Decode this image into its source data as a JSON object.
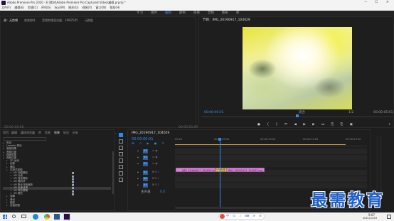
{
  "window": {
    "title": "Adobe Premiere Pro 2020 - E:\\素材\\Adobe Premiere Pro Captured Video\\编辑.prproj *",
    "controls": [
      "minimize",
      "maximize",
      "close"
    ]
  },
  "menu": [
    "文件(F)",
    "编辑(E)",
    "剪辑(C)",
    "序列(S)",
    "标记(M)",
    "图形(G)",
    "视图(V)",
    "窗口(W)",
    "帮助(H)"
  ],
  "workspaces": [
    "学习",
    "组件",
    "编辑",
    "颜色",
    "效果",
    "音频",
    "图形",
    "库"
  ],
  "active_workspace": "编辑",
  "source_panel": {
    "tabs": [
      "源：无剪辑",
      "效果控件",
      "音频剪辑混合器：19M2505",
      "元数据"
    ],
    "timecode_left": "00:00:00:00",
    "timecode_right": "00:00:00:00"
  },
  "program_monitor": {
    "tab": "节目：IMG_20190917_104029",
    "timecode": "00:00:00:01",
    "fit": "适合",
    "scale": "1/2",
    "duration": "00:00:05:01"
  },
  "effects_panel": {
    "tabs": [
      "项目：编辑",
      "媒体浏览器",
      "库",
      "信息",
      "效果",
      "标记",
      "历史"
    ],
    "active_tab": "效果",
    "tree": [
      {
        "label": "预设",
        "level": 0
      },
      {
        "label": "Lumetri 预设",
        "level": 0
      },
      {
        "label": "音频效果",
        "level": 0
      },
      {
        "label": "音频过渡",
        "level": 0
      },
      {
        "label": "视频效果",
        "level": 0
      },
      {
        "label": "视频过渡",
        "level": 0
      },
      {
        "label": "3D 运动",
        "level": 1
      },
      {
        "label": "划像",
        "level": 1
      },
      {
        "label": "擦除",
        "level": 1
      },
      {
        "label": "沉浸式视频",
        "level": 1
      },
      {
        "label": "VR 光圈擦除",
        "level": 2
      },
      {
        "label": "VR 光线",
        "level": 2
      },
      {
        "label": "VR 渐变擦除",
        "level": 2
      },
      {
        "label": "VR 随机块",
        "level": 2
      },
      {
        "label": "VR 默比乌斯缩放",
        "level": 2
      },
      {
        "label": "VR 色度泄漏",
        "level": 2,
        "selected": true
      },
      {
        "label": "VR 球形模糊",
        "level": 2
      },
      {
        "label": "VR 漏光",
        "level": 2
      },
      {
        "label": "溶解",
        "level": 1
      },
      {
        "label": "滑动",
        "level": 1
      },
      {
        "label": "缩放",
        "level": 1
      },
      {
        "label": "页面剥落",
        "level": 1
      }
    ]
  },
  "timeline": {
    "tab": "IMG_20190917_104029",
    "timecode": "00:00:00:01",
    "ruler": [
      "00:00",
      "00:00:05:00",
      "00:00:10:00",
      "00:00:15:00",
      "00:00:20:00"
    ],
    "tracks": [
      "V3",
      "V2",
      "V1",
      "A1",
      "A2",
      "A3"
    ],
    "master": "主声道",
    "master_value": "0.0",
    "clips": [
      {
        "label": "IMG_20190917_104029.jpg",
        "track": "V1"
      },
      {
        "label": "IMG_20190917_104033.jpg",
        "track": "V1"
      }
    ],
    "transition_label": "VR 色度"
  },
  "taskbar": {
    "time": "9:07",
    "date": "2021/10/15"
  },
  "watermark": "最需教育",
  "colors": {
    "accent_blue": "#2d8ceb",
    "clip_pink": "#d884d6",
    "selection": "#3a3a3a",
    "watermark_blue": "#1f5fc8"
  }
}
